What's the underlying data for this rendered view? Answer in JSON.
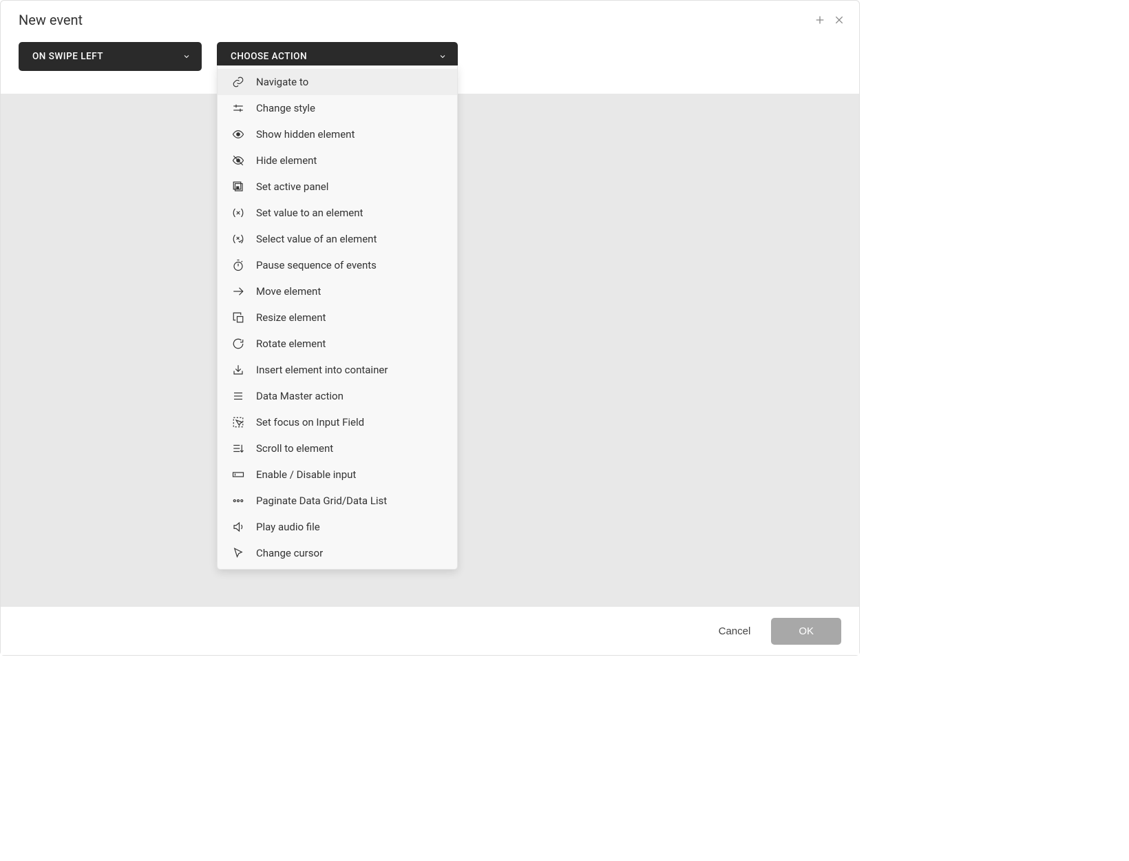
{
  "title": "New event",
  "triggerDropdown": {
    "label": "ON SWIPE LEFT"
  },
  "actionDropdown": {
    "label": "CHOOSE ACTION",
    "options": [
      {
        "icon": "link-icon",
        "label": "Navigate to",
        "hovered": true
      },
      {
        "icon": "sliders-icon",
        "label": "Change style"
      },
      {
        "icon": "eye-icon",
        "label": "Show hidden element"
      },
      {
        "icon": "eye-off-icon",
        "label": "Hide element"
      },
      {
        "icon": "panel-icon",
        "label": "Set active panel"
      },
      {
        "icon": "x-parens-icon",
        "label": "Set value to an element"
      },
      {
        "icon": "x-check-parens-icon",
        "label": "Select value of an element"
      },
      {
        "icon": "stopwatch-icon",
        "label": "Pause sequence of events"
      },
      {
        "icon": "arrow-right-icon",
        "label": "Move element"
      },
      {
        "icon": "resize-icon",
        "label": "Resize element"
      },
      {
        "icon": "rotate-icon",
        "label": "Rotate element"
      },
      {
        "icon": "insert-icon",
        "label": "Insert element into container"
      },
      {
        "icon": "bars-icon",
        "label": "Data Master action"
      },
      {
        "icon": "focus-icon",
        "label": "Set focus on Input Field"
      },
      {
        "icon": "scroll-icon",
        "label": "Scroll to element"
      },
      {
        "icon": "input-icon",
        "label": "Enable / Disable input"
      },
      {
        "icon": "dots-icon",
        "label": "Paginate Data Grid/Data List"
      },
      {
        "icon": "audio-icon",
        "label": "Play audio file"
      },
      {
        "icon": "cursor-icon",
        "label": "Change cursor"
      }
    ]
  },
  "footer": {
    "cancel": "Cancel",
    "ok": "OK"
  }
}
